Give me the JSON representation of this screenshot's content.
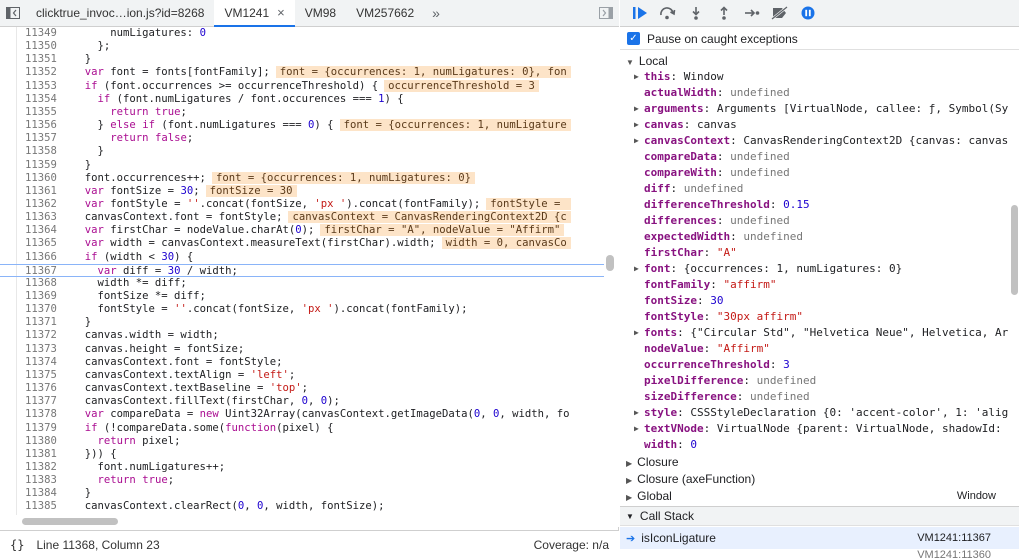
{
  "tabs": {
    "items": [
      {
        "label": "clicktrue_invoc…ion.js?id=8268"
      },
      {
        "label": "VM1241"
      },
      {
        "label": "VM98"
      },
      {
        "label": "VM257662"
      }
    ],
    "active_index": 1,
    "more_label": "»",
    "close_glyph": "×"
  },
  "editor": {
    "lines": [
      {
        "n": "11349",
        "code": "      numLigatures: 0"
      },
      {
        "n": "11350",
        "code": "    };"
      },
      {
        "n": "11351",
        "code": "  }"
      },
      {
        "n": "11352",
        "code": "  var font = fonts[fontFamily];",
        "inline": "font = {occurrences: 1, numLigatures: 0}, fon"
      },
      {
        "n": "11353",
        "code": "  if (font.occurrences >= occurrenceThreshold) {",
        "inline": "occurrenceThreshold = 3"
      },
      {
        "n": "11354",
        "code": "    if (font.numLigatures / font.occurences === 1) {"
      },
      {
        "n": "11355",
        "code": "      return true;"
      },
      {
        "n": "11356",
        "code": "    } else if (font.numLigatures === 0) {",
        "inline": "font = {occurrences: 1, numLigature"
      },
      {
        "n": "11357",
        "code": "      return false;"
      },
      {
        "n": "11358",
        "code": "    }"
      },
      {
        "n": "11359",
        "code": "  }"
      },
      {
        "n": "11360",
        "code": "  font.occurrences++;",
        "inline": "font = {occurrences: 1, numLigatures: 0}"
      },
      {
        "n": "11361",
        "code": "  var fontSize = 30;",
        "inline": "fontSize = 30"
      },
      {
        "n": "11362",
        "code": "  var fontStyle = ''.concat(fontSize, 'px ').concat(fontFamily);",
        "inline": "fontStyle = "
      },
      {
        "n": "11363",
        "code": "  canvasContext.font = fontStyle;",
        "inline": "canvasContext = CanvasRenderingContext2D {c"
      },
      {
        "n": "11364",
        "code": "  var firstChar = nodeValue.charAt(0);",
        "inline": "firstChar = \"A\", nodeValue = \"Affirm\""
      },
      {
        "n": "11365",
        "code": "  var width = canvasContext.measureText(firstChar).width;",
        "inline": "width = 0, canvasCo"
      },
      {
        "n": "11366",
        "code": "  if (width < 30) {"
      },
      {
        "n": "11367",
        "code": "    var diff = 30 / width;"
      },
      {
        "n": "11368",
        "code": "    width *= diff;"
      },
      {
        "n": "11369",
        "code": "    fontSize *= diff;"
      },
      {
        "n": "11370",
        "code": "    fontStyle = ''.concat(fontSize, 'px ').concat(fontFamily);"
      },
      {
        "n": "11371",
        "code": "  }"
      },
      {
        "n": "11372",
        "code": "  canvas.width = width;"
      },
      {
        "n": "11373",
        "code": "  canvas.height = fontSize;"
      },
      {
        "n": "11374",
        "code": "  canvasContext.font = fontStyle;"
      },
      {
        "n": "11375",
        "code": "  canvasContext.textAlign = 'left';"
      },
      {
        "n": "11376",
        "code": "  canvasContext.textBaseline = 'top';"
      },
      {
        "n": "11377",
        "code": "  canvasContext.fillText(firstChar, 0, 0);"
      },
      {
        "n": "11378",
        "code": "  var compareData = new Uint32Array(canvasContext.getImageData(0, 0, width, fo"
      },
      {
        "n": "11379",
        "code": "  if (!compareData.some(function(pixel) {"
      },
      {
        "n": "11380",
        "code": "    return pixel;"
      },
      {
        "n": "11381",
        "code": "  })) {"
      },
      {
        "n": "11382",
        "code": "    font.numLigatures++;"
      },
      {
        "n": "11383",
        "code": "    return true;"
      },
      {
        "n": "11384",
        "code": "  }"
      },
      {
        "n": "11385",
        "code": "  canvasContext.clearRect(0, 0, width, fontSize);"
      }
    ],
    "current_line": "11367"
  },
  "statusbar": {
    "braces": "{}",
    "position": "Line 11368, Column 23",
    "coverage": "Coverage: n/a"
  },
  "debugger": {
    "pause_caught_label": "Pause on caught exceptions",
    "pause_caught_checked": true,
    "local_label": "Local",
    "scope": [
      {
        "name": "this",
        "value": "Window",
        "expandable": true,
        "kind": "val"
      },
      {
        "name": "actualWidth",
        "value": "undefined",
        "kind": "undef"
      },
      {
        "name": "arguments",
        "value": "Arguments [VirtualNode, callee: ƒ, Symbol(Sy",
        "expandable": true,
        "kind": "val"
      },
      {
        "name": "canvas",
        "value": "canvas",
        "expandable": true,
        "kind": "val"
      },
      {
        "name": "canvasContext",
        "value": "CanvasRenderingContext2D {canvas: canvas",
        "expandable": true,
        "kind": "val"
      },
      {
        "name": "compareData",
        "value": "undefined",
        "kind": "undef"
      },
      {
        "name": "compareWith",
        "value": "undefined",
        "kind": "undef"
      },
      {
        "name": "diff",
        "value": "undefined",
        "kind": "undef"
      },
      {
        "name": "differenceThreshold",
        "value": "0.15",
        "kind": "num"
      },
      {
        "name": "differences",
        "value": "undefined",
        "kind": "undef"
      },
      {
        "name": "expectedWidth",
        "value": "undefined",
        "kind": "undef"
      },
      {
        "name": "firstChar",
        "value": "\"A\"",
        "kind": "str"
      },
      {
        "name": "font",
        "value": "{occurrences: 1, numLigatures: 0}",
        "expandable": true,
        "kind": "val"
      },
      {
        "name": "fontFamily",
        "value": "\"affirm\"",
        "kind": "str"
      },
      {
        "name": "fontSize",
        "value": "30",
        "kind": "num"
      },
      {
        "name": "fontStyle",
        "value": "\"30px affirm\"",
        "kind": "str"
      },
      {
        "name": "fonts",
        "value": "{\"Circular Std\", \"Helvetica Neue\", Helvetica, Ar",
        "expandable": true,
        "kind": "val"
      },
      {
        "name": "nodeValue",
        "value": "\"Affirm\"",
        "kind": "str"
      },
      {
        "name": "occurrenceThreshold",
        "value": "3",
        "kind": "num"
      },
      {
        "name": "pixelDifference",
        "value": "undefined",
        "kind": "undef"
      },
      {
        "name": "sizeDifference",
        "value": "undefined",
        "kind": "undef"
      },
      {
        "name": "style",
        "value": "CSSStyleDeclaration {0: 'accent-color', 1: 'alig",
        "expandable": true,
        "kind": "val"
      },
      {
        "name": "textVNode",
        "value": "VirtualNode {parent: VirtualNode, shadowId:",
        "expandable": true,
        "kind": "val"
      },
      {
        "name": "width",
        "value": "0",
        "kind": "num"
      }
    ],
    "other_scopes": [
      {
        "label": "Closure"
      },
      {
        "label": "Closure (axeFunction)"
      },
      {
        "label": "Global",
        "value": "Window"
      }
    ],
    "callstack_label": "Call Stack",
    "callstack": [
      {
        "fn": "isIconLigature",
        "loc": "VM1241:11367"
      }
    ],
    "callstack_next_loc": "VM1241:11360"
  },
  "colors": {
    "accent": "#1a73e8",
    "inline_value_bg": "#fde4c8",
    "keyword": "#aa0d91",
    "string": "#c41a16",
    "number": "#1c00cf"
  }
}
